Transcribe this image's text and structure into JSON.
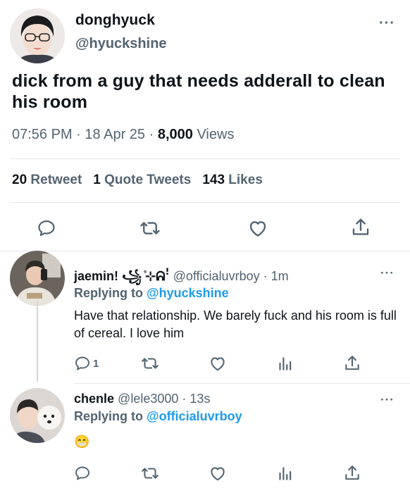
{
  "main_tweet": {
    "name": "donghyuck",
    "handle": "@hyuckshine",
    "text": "dick from a guy that needs adderall to clean his room",
    "time": "07:56 PM",
    "dot": "·",
    "date": "18 Apr 25",
    "views_count": "8,000",
    "views_label": "Views",
    "retweets_count": "20",
    "retweets_label": "Retweet",
    "quotes_count": "1",
    "quotes_label": "Quote Tweets",
    "likes_count": "143",
    "likes_label": "Likes",
    "more": "···"
  },
  "replies": [
    {
      "name": "jaemin! ꧁ ̊⊹ᕱꜝ",
      "handle": "@officialuvrboy",
      "dot": "·",
      "time": "1m",
      "replying_label": "Replying to",
      "replying_to": "@hyuckshine",
      "text": "Have that relationship. We barely fuck and his room is full of cereal. I love him",
      "reply_count": "1",
      "more": "···"
    },
    {
      "name": "chenle",
      "handle": "@lele3000",
      "dot": "·",
      "time": "13s",
      "replying_label": "Replying to",
      "replying_to": "@officialuvrboy",
      "text": "😁",
      "more": "···"
    }
  ],
  "colors": {
    "text": "#0f1419",
    "secondary": "#536471",
    "link": "#1d9bf0",
    "divider": "#e4e7ea"
  },
  "icons": [
    "reply-icon",
    "retweet-icon",
    "like-icon",
    "share-icon",
    "analytics-icon",
    "more-icon"
  ]
}
